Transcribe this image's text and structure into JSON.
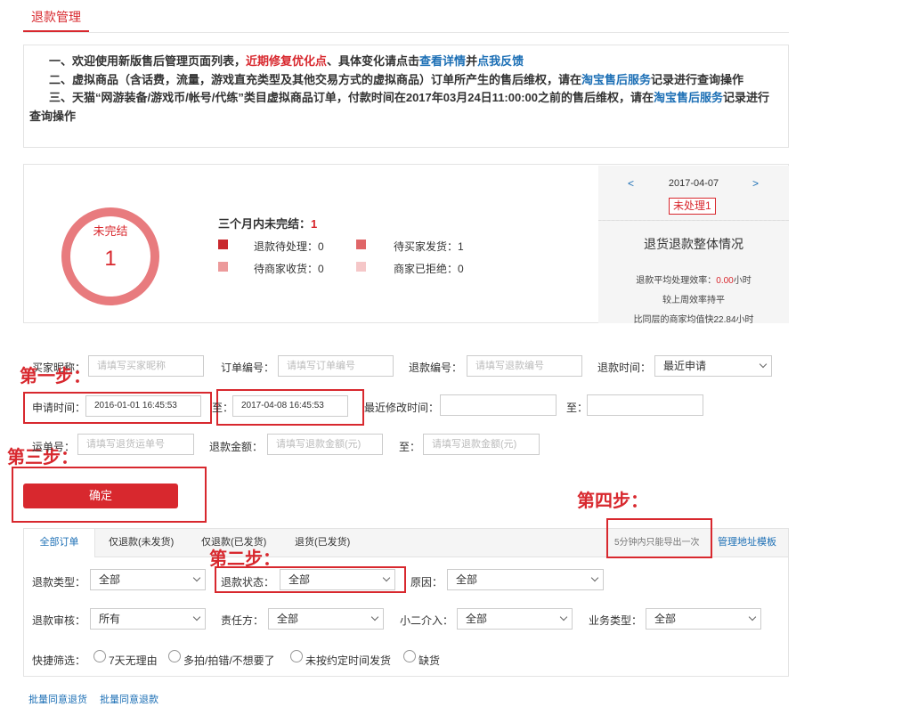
{
  "header": {
    "tab": "退款管理"
  },
  "notice": {
    "line1": {
      "a": "一、欢迎使用新版售后管理页面列表，",
      "b": "近期修复优化点",
      "c": "、具体变化请点击",
      "d": "查看详情",
      "e": "并",
      "f": "点我反馈"
    },
    "line2": {
      "a": "二、虚拟商品（含话费，流量，游戏直充类型及其他交易方式的虚拟商品）订单所产生的售后维权，请在",
      "b": "淘宝售后服务",
      "c": "记录进行查询操作"
    },
    "line3": {
      "a": "三、天猫“网游装备/游戏币/帐号/代练”类目虚拟商品订单，付款时间在2017年03月24日11:00:00之前的售后维权，请在",
      "b": "淘宝售后服务",
      "c": "记录进行查询操作"
    }
  },
  "stats": {
    "ring_label": "未完结",
    "ring_value": "1",
    "summary_label": "三个月内未完结：",
    "summary_value": "1",
    "items": [
      {
        "label": "退款待处理：0",
        "color": "#c9282d"
      },
      {
        "label": "待买家发货：1",
        "color": "#e06668"
      },
      {
        "label": "待商家收货：0",
        "color": "#ec9a9b"
      },
      {
        "label": "商家已拒绝：0",
        "color": "#f5c7c8"
      }
    ],
    "side": {
      "prev": "<",
      "next": ">",
      "date": "2017-04-07",
      "badge": "未处理1",
      "title": "退货退款整体情况",
      "eff_label": "退款平均处理效率：",
      "eff_value": "0.00",
      "eff_unit": "小时",
      "week": "较上周效率持平",
      "peer": "比同层的商家均值快22.84小时"
    }
  },
  "form": {
    "buyer_label": "买家昵称：",
    "buyer_ph": "请填写买家昵称",
    "order_label": "订单编号：",
    "order_ph": "请填写订单编号",
    "refund_no_label": "退款编号：",
    "refund_no_ph": "请填写退款编号",
    "refund_time_label": "退款时间：",
    "refund_time_value": "最近申请",
    "apply_label": "申请时间：",
    "apply_from": "2016-01-01 16:45:53",
    "to_label": "至：",
    "apply_to": "2017-04-08 16:45:53",
    "modify_label": "最近修改时间：",
    "modify_to_label": "至：",
    "waybill_label": "运单号：",
    "waybill_ph": "请填写退货运单号",
    "amount_label": "退款金额：",
    "amount_ph": "请填写退款金额(元)",
    "amount_to_label": "至：",
    "amount_to_ph": "请填写退款金额(元)",
    "confirm": "确定"
  },
  "steps": {
    "s1": "第一步：",
    "s2": "第二步：",
    "s3": "第三步：",
    "s4": "第四步："
  },
  "tabs": [
    "全部订单",
    "仅退款(未发货)",
    "仅退款(已发货)",
    "退货(已发货)"
  ],
  "export_note": "5分钟内只能导出一次",
  "manage_addr": "管理地址模板",
  "filters": {
    "type_label": "退款类型：",
    "type_value": "全部",
    "status_label": "退款状态：",
    "status_value": "全部",
    "reason_label": "原因：",
    "reason_value": "全部",
    "audit_label": "退款审核：",
    "audit_value": "所有",
    "resp_label": "责任方：",
    "resp_value": "全部",
    "xiaoer_label": "小二介入：",
    "xiaoer_value": "全部",
    "biz_label": "业务类型：",
    "biz_value": "全部",
    "quick_label": "快捷筛选：",
    "quick": [
      "7天无理由",
      "多拍/拍错/不想要了",
      "未按约定时间发货",
      "缺货"
    ]
  },
  "bottom_links": [
    "批量同意退货",
    "批量同意退款"
  ]
}
